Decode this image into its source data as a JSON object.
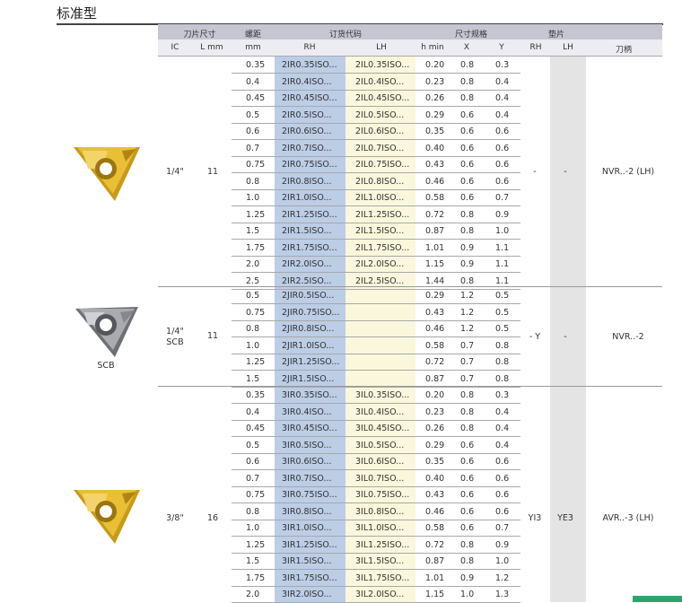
{
  "page_title": "标准型",
  "header": {
    "blade_size": "刀片尺寸",
    "pitch": "螺距",
    "order_code": "订货代码",
    "spec": "尺寸规格",
    "shim": "垫片",
    "ic": "IC",
    "l_mm": "L mm",
    "mm": "mm",
    "rh": "RH",
    "lh": "LH",
    "h_min": "h min",
    "x": "X",
    "y": "Y",
    "shim_rh": "RH",
    "shim_lh": "LH",
    "holder": "刀柄"
  },
  "groups": [
    {
      "ic": "1/4\"",
      "l": "11",
      "shim_rh": "-",
      "shim_lh": "-",
      "holder": "NVR..-2 (LH)",
      "rows": [
        {
          "pitch": "0.35",
          "rh": "2IR0.35ISO...",
          "lh": "2IL0.35ISO...",
          "h": "0.20",
          "x": "0.8",
          "y": "0.3"
        },
        {
          "pitch": "0.4",
          "rh": "2IR0.4ISO...",
          "lh": "2IL0.4ISO...",
          "h": "0.23",
          "x": "0.8",
          "y": "0.4"
        },
        {
          "pitch": "0.45",
          "rh": "2IR0.45ISO...",
          "lh": "2IL0.45ISO...",
          "h": "0.26",
          "x": "0.8",
          "y": "0.4"
        },
        {
          "pitch": "0.5",
          "rh": "2IR0.5ISO...",
          "lh": "2IL0.5ISO...",
          "h": "0.29",
          "x": "0.6",
          "y": "0.4"
        },
        {
          "pitch": "0.6",
          "rh": "2IR0.6ISO...",
          "lh": "2IL0.6ISO...",
          "h": "0.35",
          "x": "0.6",
          "y": "0.6"
        },
        {
          "pitch": "0.7",
          "rh": "2IR0.7ISO...",
          "lh": "2IL0.7ISO...",
          "h": "0.40",
          "x": "0.6",
          "y": "0.6"
        },
        {
          "pitch": "0.75",
          "rh": "2IR0.75ISO...",
          "lh": "2IL0.75ISO...",
          "h": "0.43",
          "x": "0.6",
          "y": "0.6"
        },
        {
          "pitch": "0.8",
          "rh": "2IR0.8ISO...",
          "lh": "2IL0.8ISO...",
          "h": "0.46",
          "x": "0.6",
          "y": "0.6"
        },
        {
          "pitch": "1.0",
          "rh": "2IR1.0ISO...",
          "lh": "2IL1.0ISO...",
          "h": "0.58",
          "x": "0.6",
          "y": "0.7"
        },
        {
          "pitch": "1.25",
          "rh": "2IR1.25ISO...",
          "lh": "2IL1.25ISO...",
          "h": "0.72",
          "x": "0.8",
          "y": "0.9"
        },
        {
          "pitch": "1.5",
          "rh": "2IR1.5ISO...",
          "lh": "2IL1.5ISO...",
          "h": "0.87",
          "x": "0.8",
          "y": "1.0"
        },
        {
          "pitch": "1.75",
          "rh": "2IR1.75ISO...",
          "lh": "2IL1.75ISO...",
          "h": "1.01",
          "x": "0.9",
          "y": "1.1"
        },
        {
          "pitch": "2.0",
          "rh": "2IR2.0ISO...",
          "lh": "2IL2.0ISO...",
          "h": "1.15",
          "x": "0.9",
          "y": "1.1"
        },
        {
          "pitch": "2.5",
          "rh": "2IR2.5ISO...",
          "lh": "2IL2.5ISO...",
          "h": "1.44",
          "x": "0.8",
          "y": "1.1"
        }
      ]
    },
    {
      "ic": "1/4\"",
      "ic2": "SCB",
      "label": "SCB",
      "l": "11",
      "shim_rh": "- Y",
      "shim_lh": "-",
      "holder": "NVR..-2",
      "rows": [
        {
          "pitch": "0.5",
          "rh": "2JIR0.5ISO...",
          "lh": "",
          "h": "0.29",
          "x": "1.2",
          "y": "0.5"
        },
        {
          "pitch": "0.75",
          "rh": "2JIR0.75ISO...",
          "lh": "",
          "h": "0.43",
          "x": "1.2",
          "y": "0.5"
        },
        {
          "pitch": "0.8",
          "rh": "2JIR0.8ISO...",
          "lh": "",
          "h": "0.46",
          "x": "1.2",
          "y": "0.5"
        },
        {
          "pitch": "1.0",
          "rh": "2JIR1.0ISO...",
          "lh": "",
          "h": "0.58",
          "x": "0.7",
          "y": "0.8"
        },
        {
          "pitch": "1.25",
          "rh": "2JIR1.25ISO...",
          "lh": "",
          "h": "0.72",
          "x": "0.7",
          "y": "0.8"
        },
        {
          "pitch": "1.5",
          "rh": "2JIR1.5ISO...",
          "lh": "",
          "h": "0.87",
          "x": "0.7",
          "y": "0.8"
        }
      ]
    },
    {
      "ic": "3/8\"",
      "l": "16",
      "shim_rh": "YI3",
      "shim_lh": "YE3",
      "holder": "AVR..-3 (LH)",
      "rows": [
        {
          "pitch": "0.35",
          "rh": "3IR0.35ISO...",
          "lh": "3IL0.35ISO...",
          "h": "0.20",
          "x": "0.8",
          "y": "0.3"
        },
        {
          "pitch": "0.4",
          "rh": "3IR0.4ISO...",
          "lh": "3IL0.4ISO...",
          "h": "0.23",
          "x": "0.8",
          "y": "0.4"
        },
        {
          "pitch": "0.45",
          "rh": "3IR0.45ISO...",
          "lh": "3IL0.45ISO...",
          "h": "0.26",
          "x": "0.8",
          "y": "0.4"
        },
        {
          "pitch": "0.5",
          "rh": "3IR0.5ISO...",
          "lh": "3IL0.5ISO...",
          "h": "0.29",
          "x": "0.6",
          "y": "0.4"
        },
        {
          "pitch": "0.6",
          "rh": "3IR0.6ISO...",
          "lh": "3IL0.6ISO...",
          "h": "0.35",
          "x": "0.6",
          "y": "0.6"
        },
        {
          "pitch": "0.7",
          "rh": "3IR0.7ISO...",
          "lh": "3IL0.7ISO...",
          "h": "0.40",
          "x": "0.6",
          "y": "0.6"
        },
        {
          "pitch": "0.75",
          "rh": "3IR0.75ISO...",
          "lh": "3IL0.75ISO...",
          "h": "0.43",
          "x": "0.6",
          "y": "0.6"
        },
        {
          "pitch": "0.8",
          "rh": "3IR0.8ISO...",
          "lh": "3IL0.8ISO...",
          "h": "0.46",
          "x": "0.6",
          "y": "0.6"
        },
        {
          "pitch": "1.0",
          "rh": "3IR1.0ISO...",
          "lh": "3IL1.0ISO...",
          "h": "0.58",
          "x": "0.6",
          "y": "0.7"
        },
        {
          "pitch": "1.25",
          "rh": "3IR1.25ISO...",
          "lh": "3IL1.25ISO...",
          "h": "0.72",
          "x": "0.8",
          "y": "0.9"
        },
        {
          "pitch": "1.5",
          "rh": "3IR1.5ISO...",
          "lh": "3IL1.5ISO...",
          "h": "0.87",
          "x": "0.8",
          "y": "1.0"
        },
        {
          "pitch": "1.75",
          "rh": "3IR1.75ISO...",
          "lh": "3IL1.75ISO...",
          "h": "1.01",
          "x": "0.9",
          "y": "1.2"
        },
        {
          "pitch": "2.0",
          "rh": "3IR2.0ISO...",
          "lh": "3IL2.0ISO...",
          "h": "1.15",
          "x": "1.0",
          "y": "1.3"
        }
      ]
    }
  ]
}
